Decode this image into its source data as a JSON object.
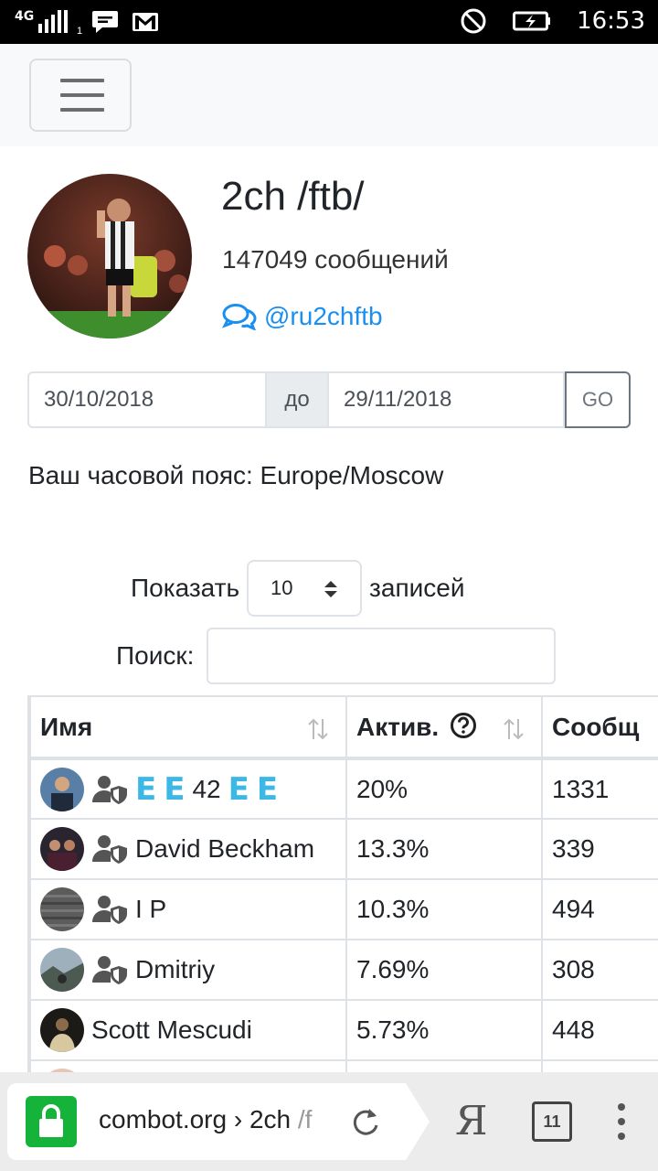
{
  "status_bar": {
    "network": "4G",
    "sim": "1",
    "time": "16:53",
    "icons": [
      "signal-icon",
      "message-icon",
      "gmail-icon",
      "do-not-disturb-icon",
      "battery-charging-icon"
    ]
  },
  "navbar": {
    "toggle_icon": "hamburger-menu-icon"
  },
  "chat": {
    "title": "2ch /ftb/",
    "messages": "147049 сообщений",
    "handle": "@ru2chftb",
    "handle_icon": "comments-icon"
  },
  "date_range": {
    "from": "30/10/2018",
    "separator": "до",
    "to": "29/11/2018",
    "go_label": "GO"
  },
  "timezone": "Ваш часовой пояс: Europe/Moscow",
  "table_controls": {
    "show_label": "Показать",
    "page_length": "10",
    "records_label": "записей",
    "search_label": "Поиск:",
    "search_value": ""
  },
  "table": {
    "headers": [
      "Имя",
      "Актив.",
      "Сообщ"
    ],
    "rows": [
      {
        "name": "42",
        "activity": "20%",
        "messages": "1331",
        "admin": true
      },
      {
        "name": "David Beckham",
        "activity": "13.3%",
        "messages": "339",
        "admin": true
      },
      {
        "name": "I P",
        "activity": "10.3%",
        "messages": "494",
        "admin": true
      },
      {
        "name": "Dmitriy",
        "activity": "7.69%",
        "messages": "308",
        "admin": true
      },
      {
        "name": "Scott Mescudi",
        "activity": "5.73%",
        "messages": "448",
        "admin": false
      }
    ],
    "row0_emoji": "E"
  },
  "browser": {
    "url_main": "combot.org › 2ch ",
    "url_faded": "/f",
    "yandex": "Я",
    "tab_count": "11"
  },
  "colors": {
    "link_blue": "#1a8ff0",
    "lock_green": "#16b33a",
    "emoji_blue": "#3cb8e6"
  }
}
